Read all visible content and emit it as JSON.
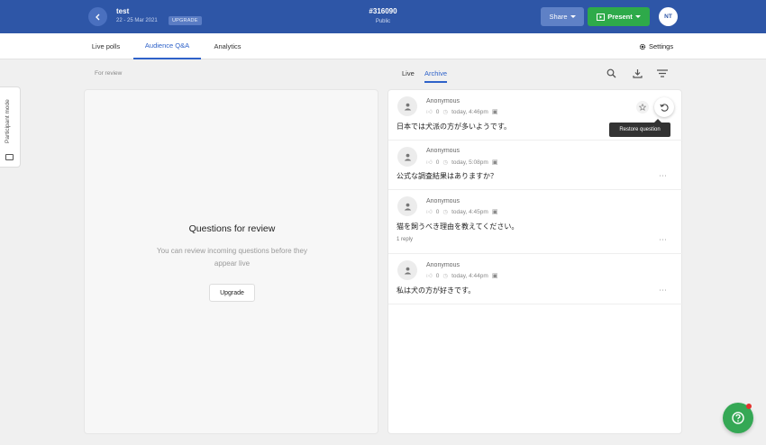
{
  "header": {
    "event_title": "test",
    "event_date": "22 - 25 Mar 2021",
    "upgrade_badge": "UPGRADE",
    "event_code": "#316090",
    "event_visibility": "Public",
    "share_label": "Share",
    "present_label": "Present",
    "avatar_initials": "NT"
  },
  "tabs": [
    {
      "label": "Live polls"
    },
    {
      "label": "Audience Q&A"
    },
    {
      "label": "Analytics"
    }
  ],
  "settings_label": "Settings",
  "participant_mode_label": "Participant mode",
  "review": {
    "section_label": "For review",
    "title": "Questions for review",
    "description": "You can review incoming questions before they appear live",
    "upgrade_label": "Upgrade"
  },
  "archive": {
    "live_tab": "Live",
    "archive_tab": "Archive",
    "tooltip": "Restore question",
    "questions": [
      {
        "author": "Anonymous",
        "likes": "0",
        "time": "today, 4:46pm",
        "text": "日本では犬派の方が多いようです。",
        "reply": ""
      },
      {
        "author": "Anonymous",
        "likes": "0",
        "time": "today, 5:08pm",
        "text": "公式な調査結果はありますか？",
        "reply": ""
      },
      {
        "author": "Anonymous",
        "likes": "0",
        "time": "today, 4:45pm",
        "text": "猫を飼うべき理由を教えてください。",
        "reply": "1 reply"
      },
      {
        "author": "Anonymous",
        "likes": "0",
        "time": "today, 4:44pm",
        "text": "私は犬の方が好きです。",
        "reply": ""
      }
    ]
  },
  "colors": {
    "topbar": "#2e56a7",
    "accent": "#2e62c9",
    "present": "#2eaa4a",
    "help": "#35a855"
  }
}
